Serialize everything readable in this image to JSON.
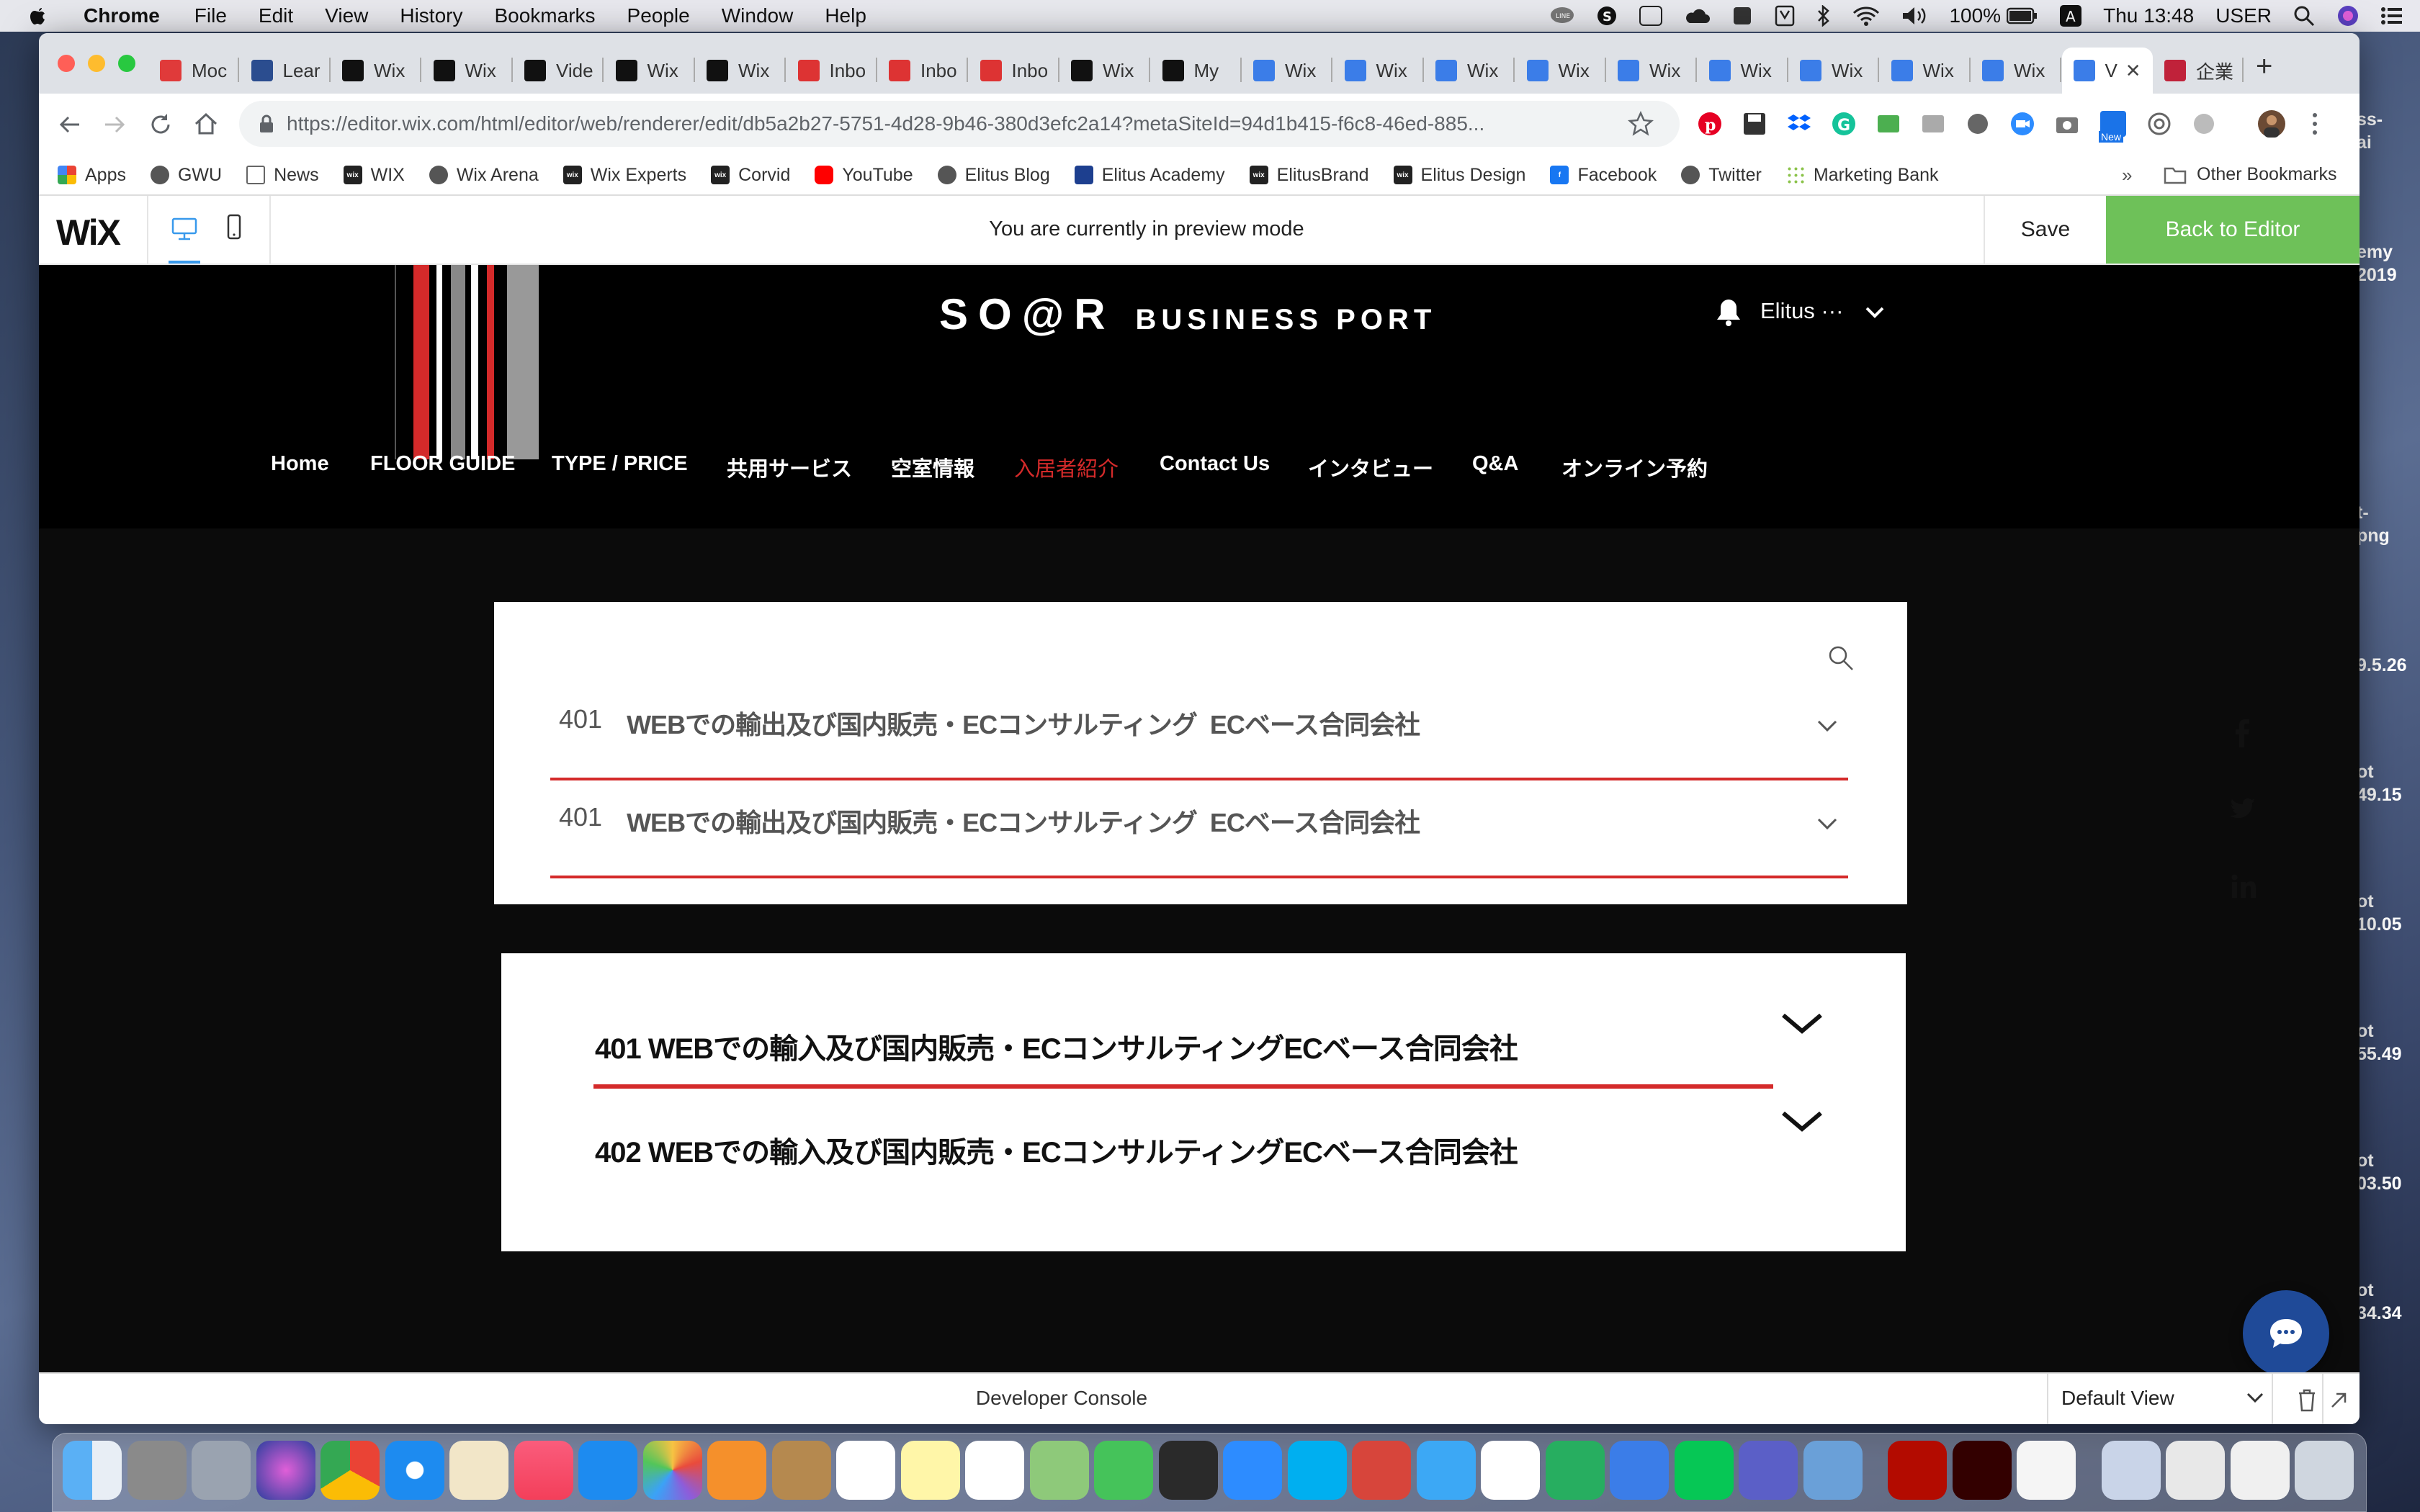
{
  "menubar": {
    "app": "Chrome",
    "items": [
      "File",
      "Edit",
      "View",
      "History",
      "Bookmarks",
      "People",
      "Window",
      "Help"
    ],
    "battery": "100%",
    "clock": "Thu 13:48",
    "user": "USER"
  },
  "browser": {
    "tabs": [
      {
        "label": "Moc",
        "color": "#e03a3a"
      },
      {
        "label": "Lear",
        "color": "#2b4d8f"
      },
      {
        "label": "Wix",
        "color": "#111"
      },
      {
        "label": "Wix",
        "color": "#111"
      },
      {
        "label": "Vide",
        "color": "#111"
      },
      {
        "label": "Wix",
        "color": "#111"
      },
      {
        "label": "Wix",
        "color": "#111"
      },
      {
        "label": "Inbo",
        "color": "#d33"
      },
      {
        "label": "Inbo",
        "color": "#d33"
      },
      {
        "label": "Inbo",
        "color": "#d33"
      },
      {
        "label": "Wix",
        "color": "#111"
      },
      {
        "label": "My",
        "color": "#111"
      },
      {
        "label": "Wix",
        "color": "#3b7de8"
      },
      {
        "label": "Wix",
        "color": "#3b7de8"
      },
      {
        "label": "Wix",
        "color": "#3b7de8"
      },
      {
        "label": "Wix",
        "color": "#3b7de8"
      },
      {
        "label": "Wix",
        "color": "#3b7de8"
      },
      {
        "label": "Wix",
        "color": "#3b7de8"
      },
      {
        "label": "Wix",
        "color": "#3b7de8"
      },
      {
        "label": "Wix",
        "color": "#3b7de8"
      },
      {
        "label": "Wix",
        "color": "#3b7de8"
      },
      {
        "label": "V",
        "color": "#3b7de8",
        "active": true
      },
      {
        "label": "企業",
        "color": "#c0223a"
      }
    ],
    "url": "https://editor.wix.com/html/editor/web/renderer/edit/db5a2b27-5751-4d28-9b46-380d3efc2a14?metaSiteId=94d1b415-f6c8-46ed-885...",
    "url_host": "editor.wix.com",
    "extension_badge": "New",
    "bookmarks": [
      {
        "label": "Apps",
        "icon": "apps-grid-icon"
      },
      {
        "label": "GWU",
        "icon": "globe-icon"
      },
      {
        "label": "News",
        "icon": "folder-icon"
      },
      {
        "label": "WIX",
        "icon": "wix-icon"
      },
      {
        "label": "Wix Arena",
        "icon": "globe-icon"
      },
      {
        "label": "Wix Experts",
        "icon": "wix-icon"
      },
      {
        "label": "Corvid",
        "icon": "wix-icon"
      },
      {
        "label": "YouTube",
        "icon": "youtube-icon"
      },
      {
        "label": "Elitus Blog",
        "icon": "globe-icon"
      },
      {
        "label": "Elitus Academy",
        "icon": "academy-icon"
      },
      {
        "label": "ElitusBrand",
        "icon": "wix-icon"
      },
      {
        "label": "Elitus Design",
        "icon": "wix-icon"
      },
      {
        "label": "Facebook",
        "icon": "facebook-icon"
      },
      {
        "label": "Twitter",
        "icon": "globe-icon"
      },
      {
        "label": "Marketing Bank",
        "icon": "dots-icon"
      }
    ],
    "bookmarks_more": "»",
    "other_bookmarks": "Other Bookmarks"
  },
  "wix": {
    "logo": "WiX",
    "preview_text": "You are currently in preview mode",
    "save": "Save",
    "back": "Back to Editor"
  },
  "site": {
    "brand": "SO@R",
    "brand_sub": "BUSINESS PORT",
    "user": "Elitus ···",
    "nav": [
      "Home",
      "FLOOR GUIDE",
      "TYPE / PRICE",
      "共用サービス",
      "空室情報",
      "入居者紹介",
      "Contact Us",
      "インタビュー",
      "Q&A",
      "オンライン予約"
    ],
    "nav_active_index": 5,
    "accent": "#d42a2a",
    "faq": [
      {
        "num": "401",
        "text": "WEBでの輸出及び国内販売・ECコンサルティング",
        "company": "ECベース合同会社"
      },
      {
        "num": "401",
        "text": "WEBでの輸出及び国内販売・ECコンサルティング",
        "company": "ECベース合同会社"
      }
    ],
    "acc": [
      {
        "text": "401 WEBでの輸入及び国内販売・ECコンサルティングECベース合同会社"
      },
      {
        "text": "402 WEBでの輸入及び国内販売・ECコンサルティングECベース合同会社"
      }
    ]
  },
  "devconsole": {
    "label": "Developer Console",
    "view": "Default View"
  },
  "desktop_side": [
    "emy",
    "2019",
    "t-",
    "png",
    "9.5.26",
    "ot",
    "49.15",
    "ot",
    "10.05",
    "ot",
    "55.49",
    "ot",
    "03.50",
    "ot",
    "34.34",
    "ss-",
    "ai"
  ]
}
